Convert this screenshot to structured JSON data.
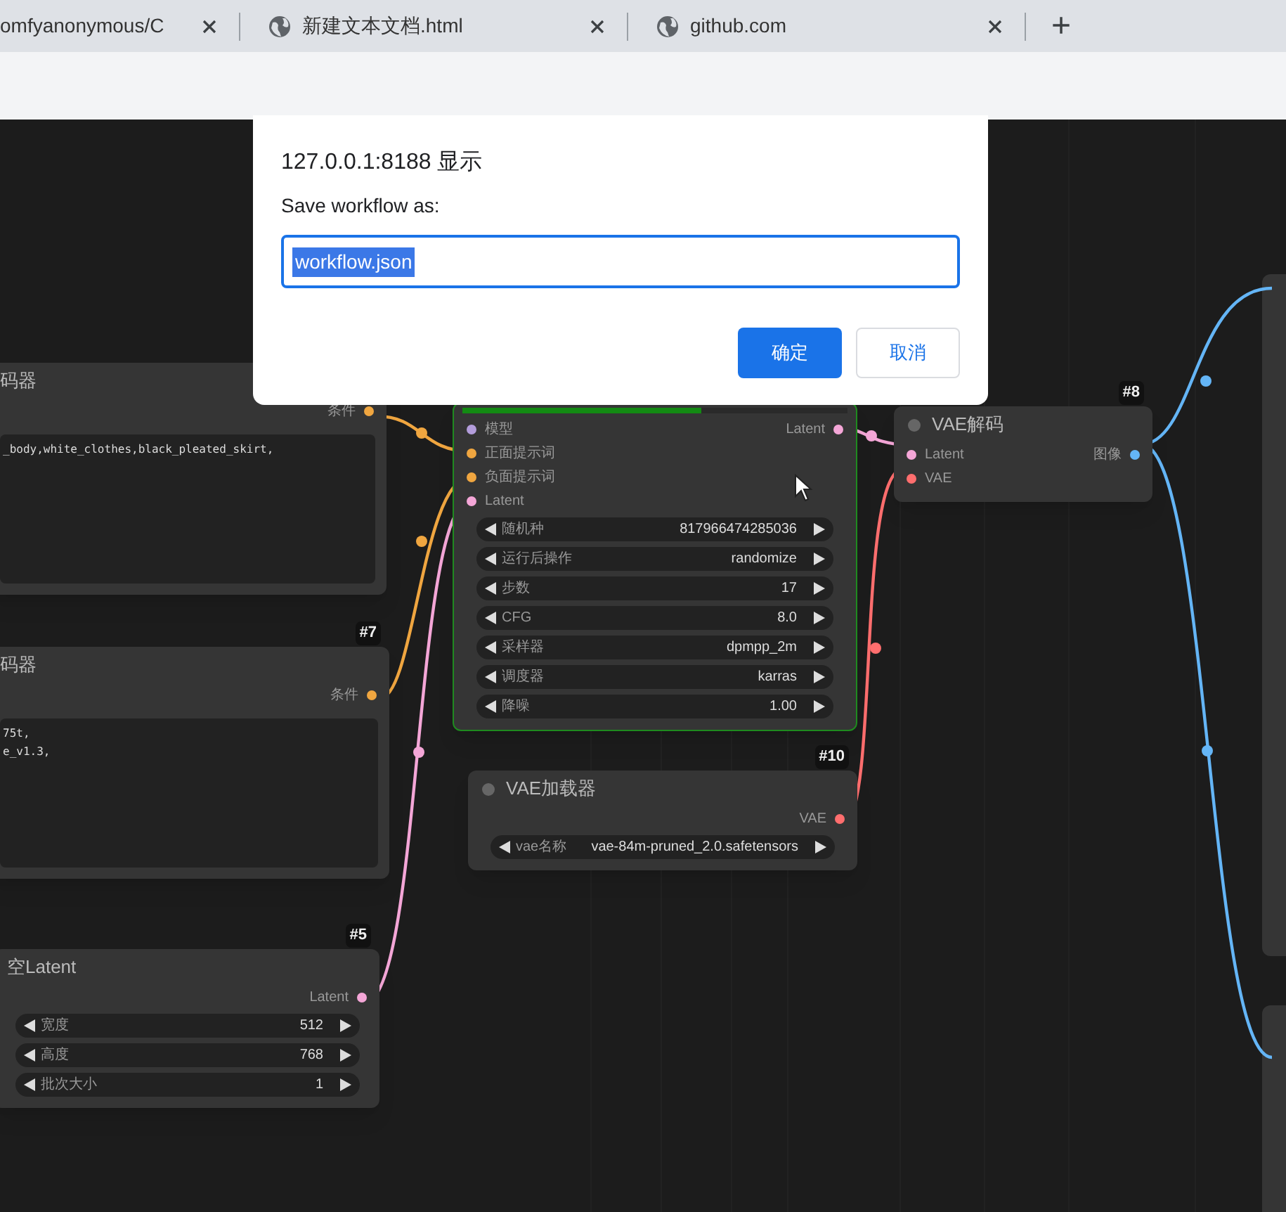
{
  "browser_tabs": [
    {
      "title": "omfyanonymous/C",
      "icon": false
    },
    {
      "title": "新建文本文档.html",
      "icon": true
    },
    {
      "title": "github.com",
      "icon": true
    }
  ],
  "new_tab": "+",
  "nodes": [
    {
      "title": "码器",
      "outputs": [
        {
          "label": "条件",
          "color": "#f0a640"
        }
      ],
      "text_lines": [
        "_body,white_clothes,black_pleated_skirt,"
      ]
    },
    {
      "id_label": "#7",
      "title": "码器",
      "outputs": [
        {
          "label": "条件",
          "color": "#f0a640"
        }
      ],
      "text_lines": [
        "75t,",
        "e_v1.3,"
      ]
    },
    {
      "progress": {
        "level": 0.62
      },
      "inputs": [
        {
          "label": "模型",
          "color": "#b39ddb"
        },
        {
          "label": "正面提示词",
          "color": "#f0a640"
        },
        {
          "label": "负面提示词",
          "color": "#f0a640"
        },
        {
          "label": "Latent",
          "color": "#f4a6d7"
        }
      ],
      "outputs": [
        {
          "label": "Latent",
          "color": "#f4a6d7"
        }
      ],
      "widgets": [
        {
          "label": "随机种",
          "value": "817966474285036"
        },
        {
          "label": "运行后操作",
          "value": "randomize"
        },
        {
          "label": "步数",
          "value": "17"
        },
        {
          "label": "CFG",
          "value": "8.0"
        },
        {
          "label": "采样器",
          "value": "dpmpp_2m"
        },
        {
          "label": "调度器",
          "value": "karras"
        },
        {
          "label": "降噪",
          "value": "1.00"
        }
      ]
    },
    {
      "id_label": "#8",
      "title": "VAE解码",
      "inputs": [
        {
          "label": "Latent",
          "color": "#f4a6d7"
        },
        {
          "label": "VAE",
          "color": "#ff6e6e"
        }
      ],
      "outputs": [
        {
          "label": "图像",
          "color": "#64b5f6"
        }
      ]
    },
    {
      "id_label": "#10",
      "title": "VAE加载器",
      "outputs": [
        {
          "label": "VAE",
          "color": "#ff6e6e"
        }
      ],
      "widgets": [
        {
          "label": "vae名称",
          "value": "vae-84m-pruned_2.0.safetensors"
        }
      ]
    },
    {
      "id_label": "#5",
      "title": "空Latent",
      "outputs": [
        {
          "label": "Latent",
          "color": "#f4a6d7"
        }
      ],
      "widgets": [
        {
          "label": "宽度",
          "value": "512"
        },
        {
          "label": "高度",
          "value": "768"
        },
        {
          "label": "批次大小",
          "value": "1"
        }
      ]
    }
  ],
  "dialog": {
    "title": "127.0.0.1:8188 显示",
    "message": "Save workflow as:",
    "value": "workflow.json",
    "value_selected": true,
    "buttons": [
      {
        "label": "确定",
        "primary": true
      },
      {
        "label": "取消",
        "primary": false
      }
    ]
  }
}
